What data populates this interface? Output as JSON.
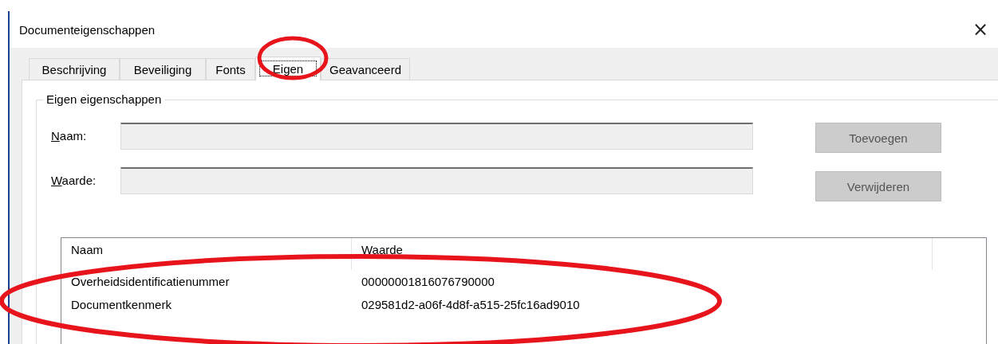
{
  "window": {
    "title": "Documenteigenschappen",
    "close": "×"
  },
  "tabs": [
    {
      "label": "Beschrijving",
      "selected": false
    },
    {
      "label": "Beveiliging",
      "selected": false
    },
    {
      "label": "Fonts",
      "selected": false
    },
    {
      "label": "Eigen",
      "selected": true
    },
    {
      "label": "Geavanceerd",
      "selected": false
    }
  ],
  "group": {
    "title": "Eigen eigenschappen",
    "fields": [
      {
        "label": "Naam:",
        "disabled": true
      },
      {
        "label": "Waarde:",
        "disabled": true
      }
    ],
    "buttons": [
      {
        "label": "Toevoegen",
        "disabled": true
      },
      {
        "label": "Verwijderen",
        "disabled": true
      }
    ]
  },
  "table": {
    "columns": [
      "Naam",
      "Waarde"
    ],
    "rows": [
      [
        "Overheidsidentificatienummer",
        "00000001816076790000"
      ],
      [
        "Documentkenmerk",
        "029581d2-a06f-4d8f-a515-25fc16ad9010"
      ]
    ]
  }
}
